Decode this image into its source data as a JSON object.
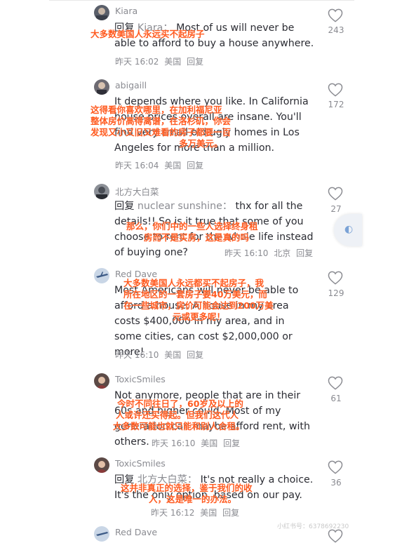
{
  "comments": [
    {
      "username": "Kiara",
      "reply_prefix": "回复",
      "reply_target": "Kiara：",
      "text": "Most of us will never be able to afford to buy a house anywhere.",
      "translation": "大多数美国人永远买不起房子",
      "date": "昨天 16:02",
      "location": "美国",
      "reply_label": "回复",
      "likes": "243"
    },
    {
      "username": "abigaill",
      "text": "It depends where you like. In California house prices overall are insane. You'll find very small old ugly homes in Los Angeles for more than a million.",
      "translation_lines": [
        "这得看你喜欢哪里，在加利福尼亚",
        "整体房价高得离谱，在洛杉矶，你会",
        "发现又小又旧又难看的房子都要一百",
        "多万美元。"
      ],
      "date": "昨天 16:04",
      "location": "美国",
      "reply_label": "回复",
      "likes": "172"
    },
    {
      "username": "北方大白菜",
      "reply_prefix": "回复",
      "reply_target": "nuclear sunshine：",
      "text": "thx for all the details!! So is it true that some of you choose to rent for the whole life instead of buying one?",
      "translation_lines": [
        "那么，你们中的一些人选择终身租",
        "房而不是买房，这是真的吗"
      ],
      "date": "昨天 16:10",
      "location": "北京",
      "reply_label": "回复",
      "likes": "27"
    },
    {
      "username": "Red Dave",
      "text": "Most Americans will never be able to afford a house. A house in my area costs $400,000 in my area, and in some cities, can cost $2,000,000 or more!",
      "translation_lines": [
        "大多数美国人永远都买不起房子，我",
        "所在地区的一套房子要40万美元，而",
        "在一些城市，房价可能会达到200万美",
        "元或更多呢！"
      ],
      "date": "昨天 16:10",
      "location": "美国",
      "reply_label": "回复",
      "likes": "129"
    },
    {
      "username": "ToxicSmiles",
      "text": "Not anymore, people that are in their 60s and higher could. Most of my generation can maybe afford rent, with others.",
      "translation_lines": [
        "今时不同往日了，60岁及以上的",
        "人或许还买得起。但我们这代人",
        "大多数可能也就只能和别人合租。"
      ],
      "date": "昨天 16:10",
      "location": "美国",
      "reply_label": "回复",
      "likes": "61"
    },
    {
      "username": "ToxicSmiles",
      "reply_prefix": "回复",
      "reply_target": "北方大白菜：",
      "text": "It's not really a choice. It's the only option, based on our pay.",
      "translation_lines": [
        "这并非真正的选择，鉴于我们的收",
        "入，这是唯一的办法。"
      ],
      "date": "昨天 16:12",
      "location": "美国",
      "reply_label": "回复",
      "likes": "36"
    },
    {
      "username": "Red Dave"
    }
  ],
  "watermark": "小红书号：6378692230",
  "side_button_icon": "translate-icon",
  "colors": {
    "accent_translation": "#ff5a1f",
    "muted": "#8a8b91",
    "text": "#2b2c33"
  }
}
